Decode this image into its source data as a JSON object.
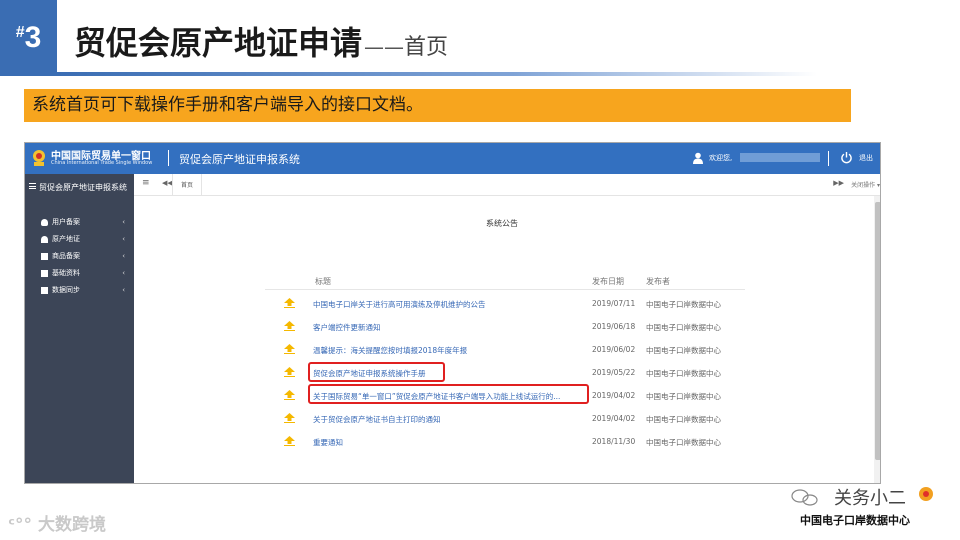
{
  "slide": {
    "hash": "#",
    "number": "3",
    "title": "贸促会原产地证申请",
    "dash": "——",
    "subtitle": "首页",
    "caption": "系统首页可下载操作手册和客户端导入的接口文档。"
  },
  "portal": {
    "logo_cn": "中国国际贸易单一窗口",
    "logo_en": "China International Trade Single Window",
    "system_title": "贸促会原产地证申报系统",
    "welcome": "欢迎您,",
    "logout": "退出"
  },
  "sidebar": {
    "header": "贸促会原产地证申报系统",
    "items": [
      {
        "label": "用户备案",
        "icon": "user-icon"
      },
      {
        "label": "原产地证",
        "icon": "person-icon"
      },
      {
        "label": "商品备案",
        "icon": "list-icon"
      },
      {
        "label": "基础资料",
        "icon": "grid-icon"
      },
      {
        "label": "数据同步",
        "icon": "grid-icon"
      }
    ]
  },
  "tabs": {
    "home": "首页",
    "close_ops": "关闭操作"
  },
  "notices": {
    "title": "系统公告",
    "columns": {
      "title": "标题",
      "date": "发布日期",
      "publisher": "发布者"
    },
    "rows": [
      {
        "title": "中国电子口岸关于进行高可用演练及停机维护的公告",
        "date": "2019/07/11",
        "publisher": "中国电子口岸数据中心"
      },
      {
        "title": "客户端控件更新通知",
        "date": "2019/06/18",
        "publisher": "中国电子口岸数据中心"
      },
      {
        "title": "温馨提示：海关提醒您按时填报2018年度年报",
        "date": "2019/06/02",
        "publisher": "中国电子口岸数据中心"
      },
      {
        "title": "贸促会原产地证申报系统操作手册",
        "date": "2019/05/22",
        "publisher": "中国电子口岸数据中心",
        "highlighted": true
      },
      {
        "title": "关于国际贸易“单一窗口”贸促会原产地证书客户端导入功能上线试运行的...",
        "date": "2019/04/02",
        "publisher": "中国电子口岸数据中心",
        "highlighted": true
      },
      {
        "title": "关于贸促会原产地证书自主打印的通知",
        "date": "2019/04/02",
        "publisher": "中国电子口岸数据中心"
      },
      {
        "title": "重要通知",
        "date": "2018/11/30",
        "publisher": "中国电子口岸数据中心"
      }
    ]
  },
  "watermarks": {
    "left": "大数跨境",
    "right_brand": "关务小二",
    "right_footer": "中国电子口岸数据中心"
  },
  "colors": {
    "slide_accent": "#3a6db3",
    "caption_bar": "#f7a51e",
    "portal_header": "#3370c0",
    "sidebar": "#3c4557",
    "highlight": "#e02020",
    "link": "#3567b5",
    "pin": "#f5b800"
  }
}
